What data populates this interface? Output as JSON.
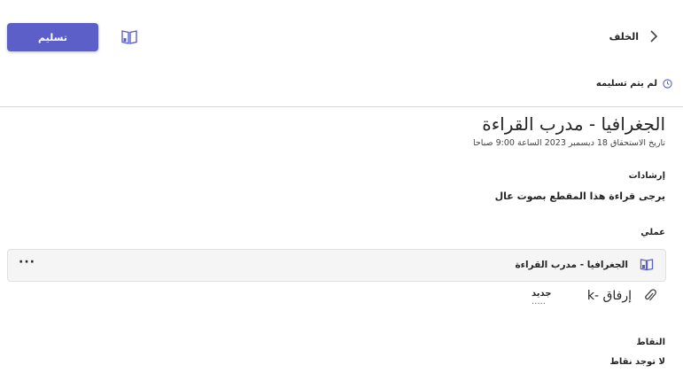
{
  "header": {
    "back_label": "الخلف",
    "submit_label": "تسليم"
  },
  "status": {
    "text": "لم يتم تسليمه"
  },
  "assignment": {
    "title": "الجغرافيا - مدرب القراءة",
    "due": "تاريخ الاستحقاق 18 ديسمبر 2023 الساعة 9:00 صباحا"
  },
  "instructions": {
    "heading": "إرشادات",
    "text": "يرجى قراءة هذا المقطع بصوت عال"
  },
  "my_work": {
    "heading": "عملي",
    "items": [
      {
        "title": "الجغرافيا - مدرب القراءة"
      }
    ],
    "more_label": "···"
  },
  "attach": {
    "label": "إرفاق -k",
    "new_label": "جديد",
    "new_suffix": "....."
  },
  "points": {
    "heading": "النقاط",
    "text": "لا توجد نقاط"
  },
  "colors": {
    "accent": "#5b5fc7",
    "card_bg": "#f5f5f5"
  },
  "icons": {
    "back": "chevron-left-icon",
    "status": "clock-icon",
    "reader": "immersive-reader-icon",
    "book": "book-icon",
    "attach": "paperclip-icon",
    "more": "more-icon"
  }
}
